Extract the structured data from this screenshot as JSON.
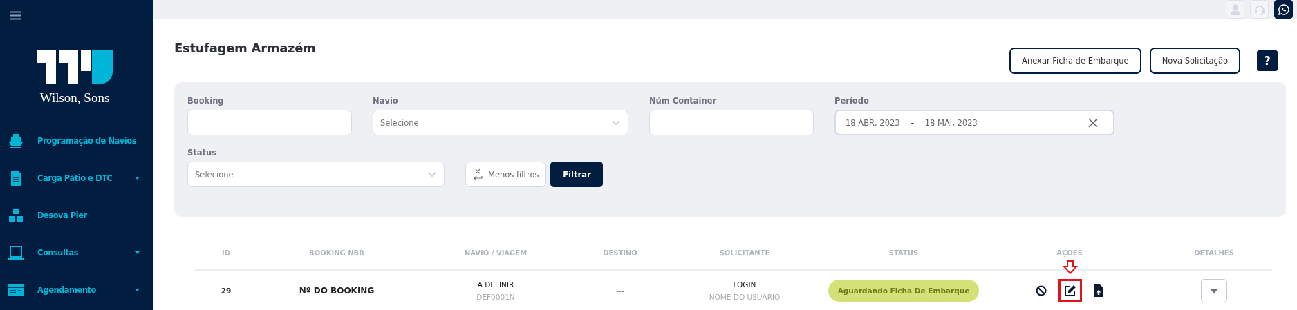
{
  "sidebar": {
    "logo_text": "Wilson, Sons",
    "items": [
      {
        "label": "Programação de Navios",
        "kind": "ship",
        "has_submenu": false
      },
      {
        "label": "Carga Pátio e DTC",
        "kind": "document",
        "has_submenu": true
      },
      {
        "label": "Desova Pier",
        "kind": "boxes",
        "has_submenu": false
      },
      {
        "label": "Consultas",
        "kind": "monitor",
        "has_submenu": true
      },
      {
        "label": "Agendamento",
        "kind": "card",
        "has_submenu": true
      }
    ]
  },
  "topbar": {
    "icons": [
      {
        "kind": "user",
        "active": false
      },
      {
        "kind": "headset",
        "active": false
      },
      {
        "kind": "chat",
        "active": true
      }
    ]
  },
  "page": {
    "title": "Estufagem Armazém",
    "buttons": [
      "Anexar Ficha de Embarque",
      "Nova Solicitação"
    ],
    "help": "?"
  },
  "filters": {
    "fields": [
      {
        "label": "Booking",
        "kind": "text"
      },
      {
        "label": "Navio",
        "kind": "select",
        "placeholder": "Selecione"
      },
      {
        "label": "Núm Container",
        "kind": "text"
      },
      {
        "label": "Período",
        "kind": "daterange",
        "start": "18 ABR, 2023",
        "separator": "-",
        "end": "18 MAI, 2023"
      },
      {
        "label": "Status",
        "kind": "select",
        "placeholder": "Selecione"
      }
    ],
    "less_filters": "Menos filtros",
    "submit": "Filtrar"
  },
  "table": {
    "columns": [
      "ID",
      "BOOKING NBR",
      "NAVIO / VIAGEM",
      "DESTINO",
      "SOLICITANTE",
      "STATUS",
      "AÇÕES",
      "DETALHES"
    ],
    "rows": [
      {
        "id": "29",
        "booking": "Nº DO BOOKING",
        "navio": "A DEFINIR",
        "viagem": "DEF0001N",
        "destino": "---",
        "login": "LOGIN",
        "usuario": "NOME DO USUÁRIO",
        "status": "Aguardando Ficha De Embarque",
        "color": "#d4e177",
        "actions": [
          {
            "kind": "block",
            "highlighted": false
          },
          {
            "kind": "edit",
            "highlighted": true
          },
          {
            "kind": "upload",
            "highlighted": false
          }
        ]
      }
    ]
  }
}
